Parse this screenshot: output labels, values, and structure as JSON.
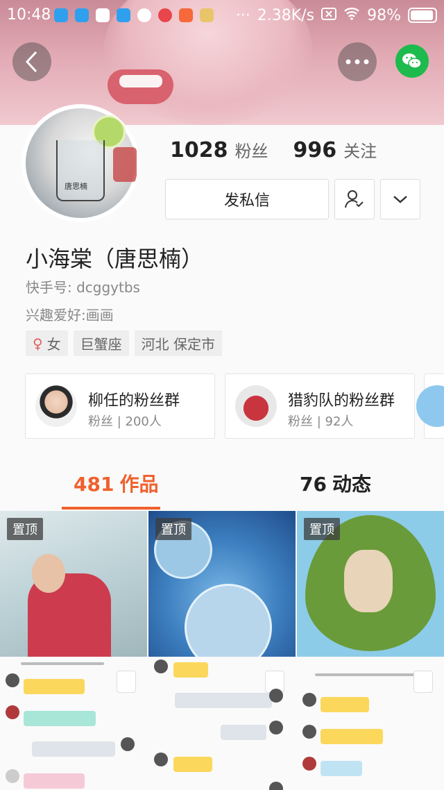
{
  "status_bar": {
    "time": "10:48",
    "speed": "2.38K/s",
    "battery": "98%"
  },
  "profile": {
    "fans_count": "1028",
    "fans_label": "粉丝",
    "following_count": "996",
    "following_label": "关注",
    "message_button": "发私信",
    "name": "小海棠（唐思楠）",
    "kuaishou_id": "快手号: dcggytbs",
    "hobby": "兴趣爱好:画画",
    "tags": [
      {
        "symbol": "♀",
        "label": "女"
      },
      {
        "label": "巨蟹座"
      },
      {
        "label": "河北 保定市"
      }
    ],
    "avatar_text": "唐思楠"
  },
  "groups": [
    {
      "name": "柳任的粉丝群",
      "sub": "粉丝 | 200人"
    },
    {
      "name": "猎豹队的粉丝群",
      "sub": "粉丝 | 92人"
    }
  ],
  "tabs": {
    "works_count": "481",
    "works_label": "作品",
    "moments_count": "76",
    "moments_label": "动态"
  },
  "grid": {
    "pinned_label": "置顶"
  },
  "colors": {
    "accent": "#f0612d",
    "wechat": "#1dbb4d"
  },
  "icons": [
    "back-icon",
    "more-icon",
    "wechat-icon",
    "follow-user-icon",
    "chevron-down-icon",
    "female-icon"
  ]
}
